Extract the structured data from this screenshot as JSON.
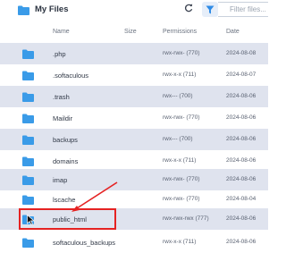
{
  "header": {
    "title": "My Files",
    "filter_placeholder": "Filter files...",
    "folder_icon": "folder-icon",
    "refresh_icon": "refresh-icon",
    "filter_icon": "funnel-icon"
  },
  "columns": {
    "name": "Name",
    "size": "Size",
    "permissions": "Permissions",
    "date": "Date"
  },
  "rows": [
    {
      "name": ".php",
      "permissions": "rwx-rwx- (770)",
      "date": "2024-08-08"
    },
    {
      "name": ".softaculous",
      "permissions": "rwx-x-x (711)",
      "date": "2024-08-07"
    },
    {
      "name": ".trash",
      "permissions": "rwx--- (700)",
      "date": "2024-08-06"
    },
    {
      "name": "Maildir",
      "permissions": "rwx-rwx- (770)",
      "date": "2024-08-06"
    },
    {
      "name": "backups",
      "permissions": "rwx--- (700)",
      "date": "2024-08-06"
    },
    {
      "name": "domains",
      "permissions": "rwx-x-x (711)",
      "date": "2024-08-06"
    },
    {
      "name": "imap",
      "permissions": "rwx-rwx- (770)",
      "date": "2024-08-06"
    },
    {
      "name": "lscache",
      "permissions": "rwx-rwx- (770)",
      "date": "2024-08-04"
    },
    {
      "name": "public_html",
      "permissions": "rwx-rwx-rwx (777)",
      "date": "2024-08-06"
    },
    {
      "name": "softaculous_backups",
      "permissions": "rwx-x-x (711)",
      "date": "2024-08-06"
    }
  ],
  "colors": {
    "folder": "#3a9be8",
    "row_shade": "#dfe3ee",
    "highlight": "#e52222",
    "filter_bg": "#e6eef9"
  }
}
